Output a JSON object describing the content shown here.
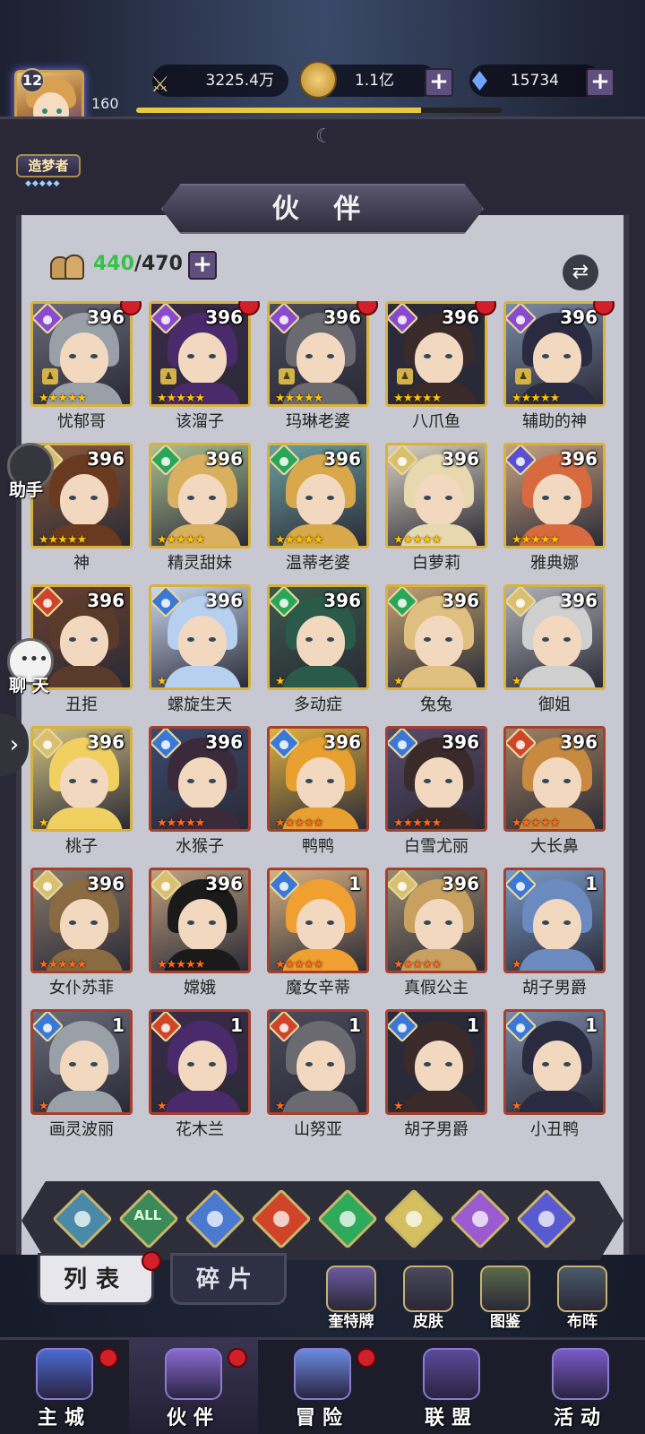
{
  "player": {
    "level": "12",
    "num": "160",
    "title": "造梦者",
    "title_stars": "◆◆◆◆◆",
    "xp_progress": 0.78
  },
  "resources": {
    "power": "3225.4万",
    "gold": "1.1亿",
    "gems": "15734"
  },
  "panel": {
    "title": "伙 伴",
    "owned": "440",
    "capacity": "/470"
  },
  "side": {
    "helper": "助手",
    "chat": "聊 天"
  },
  "companions": [
    {
      "name": "忧郁哥",
      "level": "396",
      "stars": "★★★★★",
      "element": "moon",
      "frame": "gold",
      "dot": true,
      "rank": true
    },
    {
      "name": "该溜子",
      "level": "396",
      "stars": "★★★★★",
      "element": "moon",
      "frame": "gold",
      "dot": true,
      "rank": true
    },
    {
      "name": "玛琳老婆",
      "level": "396",
      "stars": "★★★★★",
      "element": "moon",
      "frame": "gold",
      "dot": true,
      "rank": true
    },
    {
      "name": "八爪鱼",
      "level": "396",
      "stars": "★★★★★",
      "element": "moon",
      "frame": "gold",
      "dot": true,
      "rank": true
    },
    {
      "name": "辅助的神",
      "level": "396",
      "stars": "★★★★★",
      "element": "moon",
      "frame": "gold",
      "dot": true,
      "rank": true
    },
    {
      "name": "神",
      "level": "396",
      "stars": "★★★★★",
      "element": "light",
      "frame": "gold",
      "dot": false,
      "rank": false
    },
    {
      "name": "精灵甜妹",
      "level": "396",
      "stars": "★★★★★",
      "element": "wind",
      "frame": "gold",
      "dot": false,
      "rank": false
    },
    {
      "name": "温蒂老婆",
      "level": "396",
      "stars": "★★★★★",
      "element": "wind",
      "frame": "gold",
      "dot": false,
      "rank": false
    },
    {
      "name": "白萝莉",
      "level": "396",
      "stars": "★★★★★",
      "element": "light",
      "frame": "gold",
      "dot": false,
      "rank": false
    },
    {
      "name": "雅典娜",
      "level": "396",
      "stars": "★★★★★",
      "element": "star",
      "frame": "gold",
      "dot": false,
      "rank": false
    },
    {
      "name": "丑拒",
      "level": "396",
      "stars": "★",
      "element": "fire",
      "frame": "gold",
      "dot": false,
      "rank": false
    },
    {
      "name": "螺旋生天",
      "level": "396",
      "stars": "★",
      "element": "water",
      "frame": "gold",
      "dot": false,
      "rank": false
    },
    {
      "name": "多动症",
      "level": "396",
      "stars": "★",
      "element": "wind",
      "frame": "gold",
      "dot": false,
      "rank": false
    },
    {
      "name": "兔兔",
      "level": "396",
      "stars": "★",
      "element": "wind",
      "frame": "gold",
      "dot": false,
      "rank": false
    },
    {
      "name": "御姐",
      "level": "396",
      "stars": "★",
      "element": "light",
      "frame": "gold",
      "dot": false,
      "rank": false
    },
    {
      "name": "桃子",
      "level": "396",
      "stars": "★",
      "element": "light",
      "frame": "gold",
      "dot": false,
      "rank": false
    },
    {
      "name": "水猴子",
      "level": "396",
      "stars": "★★★★★",
      "element": "water",
      "frame": "red",
      "dot": false,
      "rank": false
    },
    {
      "name": "鸭鸭",
      "level": "396",
      "stars": "★★★★★",
      "element": "water",
      "frame": "red",
      "dot": false,
      "rank": false
    },
    {
      "name": "白雪尤丽",
      "level": "396",
      "stars": "★★★★★",
      "element": "water",
      "frame": "red",
      "dot": false,
      "rank": false
    },
    {
      "name": "大长鼻",
      "level": "396",
      "stars": "★★★★★",
      "element": "fire",
      "frame": "red",
      "dot": false,
      "rank": false
    },
    {
      "name": "女仆苏菲",
      "level": "396",
      "stars": "★★★★★",
      "element": "light",
      "frame": "red",
      "dot": false,
      "rank": false
    },
    {
      "name": "嫦娥",
      "level": "396",
      "stars": "★★★★★",
      "element": "light",
      "frame": "red",
      "dot": false,
      "rank": false
    },
    {
      "name": "魔女辛蒂",
      "level": "1",
      "stars": "★★★★★",
      "element": "water",
      "frame": "red",
      "dot": false,
      "rank": false
    },
    {
      "name": "真假公主",
      "level": "396",
      "stars": "★★★★★",
      "element": "light",
      "frame": "red",
      "dot": false,
      "rank": false
    },
    {
      "name": "胡子男爵",
      "level": "1",
      "stars": "★",
      "element": "water",
      "frame": "red",
      "dot": false,
      "rank": false
    },
    {
      "name": "画灵波丽",
      "level": "1",
      "stars": "★",
      "element": "water",
      "frame": "red",
      "dot": false,
      "rank": false
    },
    {
      "name": "花木兰",
      "level": "1",
      "stars": "★",
      "element": "fire",
      "frame": "red",
      "dot": false,
      "rank": false
    },
    {
      "name": "山努亚",
      "level": "1",
      "stars": "★",
      "element": "fire",
      "frame": "red",
      "dot": false,
      "rank": false
    },
    {
      "name": "胡子男爵",
      "level": "1",
      "stars": "★",
      "element": "water",
      "frame": "red",
      "dot": false,
      "rank": false
    },
    {
      "name": "小丑鸭",
      "level": "1",
      "stars": "★",
      "element": "water",
      "frame": "red",
      "dot": false,
      "rank": false
    }
  ],
  "filters": [
    {
      "icon": "element-filter-base-icon",
      "color": "#4a8aa8"
    },
    {
      "icon": "element-filter-all-icon",
      "color": "#3c8a5a",
      "label": "ALL"
    },
    {
      "icon": "element-filter-water-icon",
      "color": "#4a7ad0"
    },
    {
      "icon": "element-filter-fire-icon",
      "color": "#d0442a"
    },
    {
      "icon": "element-filter-wind-icon",
      "color": "#2eaa5a"
    },
    {
      "icon": "element-filter-light-icon",
      "color": "#d4c060"
    },
    {
      "icon": "element-filter-moon-icon",
      "color": "#9a5ad0"
    },
    {
      "icon": "element-filter-star-icon",
      "color": "#5a5ad0"
    }
  ],
  "subtabs": {
    "list": "列表",
    "fragments": "碎片"
  },
  "tools": [
    "奎特牌",
    "皮肤",
    "图鉴",
    "布阵"
  ],
  "nav": [
    "主城",
    "伙伴",
    "冒险",
    "联盟",
    "活动"
  ],
  "colors": {
    "moon": "#8a4ad0",
    "light": "#d8c070",
    "wind": "#2aa65a",
    "water": "#3a78d8",
    "fire": "#d0442a",
    "star": "#5850d0"
  }
}
